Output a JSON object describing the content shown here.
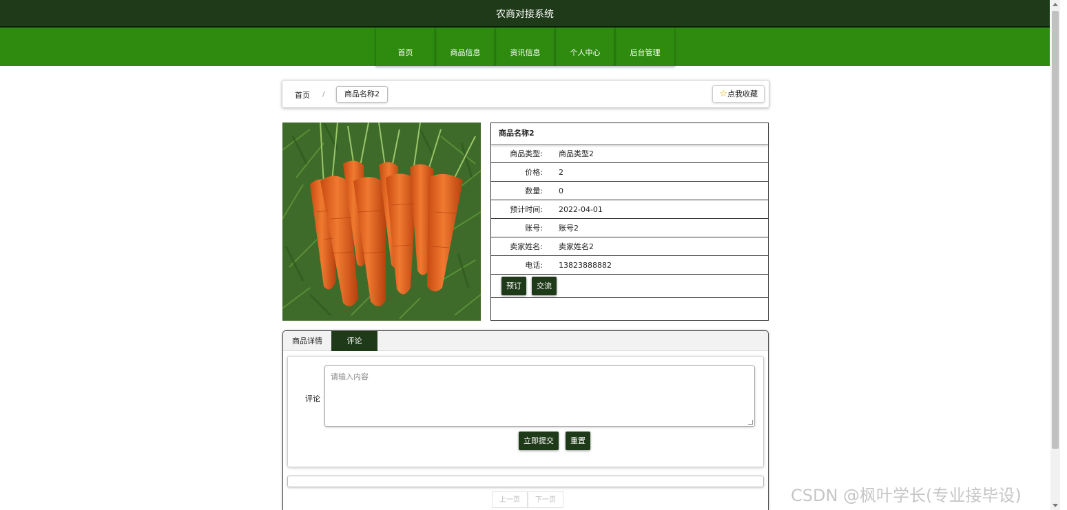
{
  "header": {
    "title": "农商对接系统"
  },
  "nav": {
    "items": [
      {
        "label": "首页"
      },
      {
        "label": "商品信息"
      },
      {
        "label": "资讯信息"
      },
      {
        "label": "个人中心"
      },
      {
        "label": "后台管理"
      }
    ]
  },
  "breadcrumb": {
    "home": "首页",
    "separator": "/",
    "current": "商品名称2"
  },
  "favorite": {
    "label": "点我收藏",
    "icon": "star-outline-icon"
  },
  "product": {
    "image_alt": "carrots-photo",
    "name": "商品名称2",
    "fields": [
      {
        "label": "商品类型:",
        "value": "商品类型2"
      },
      {
        "label": "价格:",
        "value": "2"
      },
      {
        "label": "数量:",
        "value": "0"
      },
      {
        "label": "预计时间:",
        "value": "2022-04-01"
      },
      {
        "label": "账号:",
        "value": "账号2"
      },
      {
        "label": "卖家姓名:",
        "value": "卖家姓名2"
      },
      {
        "label": "电话:",
        "value": "13823888882"
      }
    ],
    "actions": {
      "reserve": "预订",
      "chat": "交流"
    }
  },
  "tabs": {
    "details": "商品详情",
    "comments": "评论"
  },
  "comment_form": {
    "label": "评论",
    "placeholder": "请输入内容",
    "submit": "立即提交",
    "reset": "重置"
  },
  "pager": {
    "prev": "上一页",
    "next": "下一页"
  },
  "watermark": "CSDN @枫叶学长(专业接毕设)",
  "colors": {
    "header_dark": "#1f3a19",
    "nav_green": "#2e8b10",
    "button_dark": "#1f3a19"
  }
}
